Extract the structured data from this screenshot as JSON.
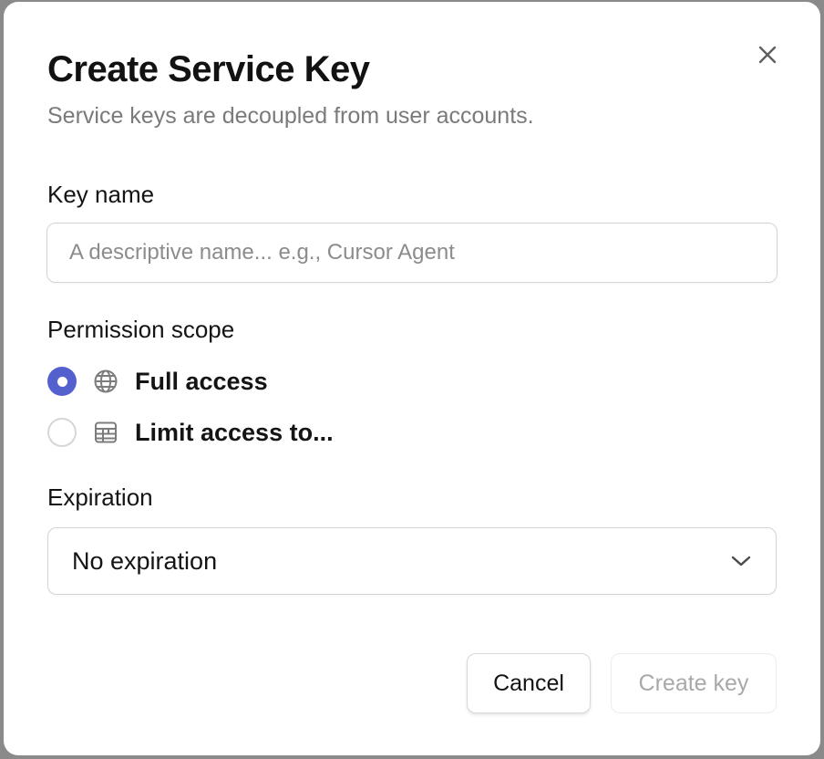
{
  "dialog": {
    "title": "Create Service Key",
    "subtitle": "Service keys are decoupled from user accounts."
  },
  "key_name": {
    "label": "Key name",
    "value": "",
    "placeholder": "A descriptive name... e.g., Cursor Agent"
  },
  "permission": {
    "label": "Permission scope",
    "options": [
      {
        "label": "Full access",
        "icon": "globe-icon",
        "selected": true
      },
      {
        "label": "Limit access to...",
        "icon": "table-icon",
        "selected": false
      }
    ]
  },
  "expiration": {
    "label": "Expiration",
    "selected": "No expiration"
  },
  "buttons": {
    "cancel": "Cancel",
    "create": "Create key",
    "create_disabled": true
  },
  "colors": {
    "accent": "#5560cf",
    "muted_text": "#7a7a7a",
    "disabled_text": "#a9a9a9"
  }
}
